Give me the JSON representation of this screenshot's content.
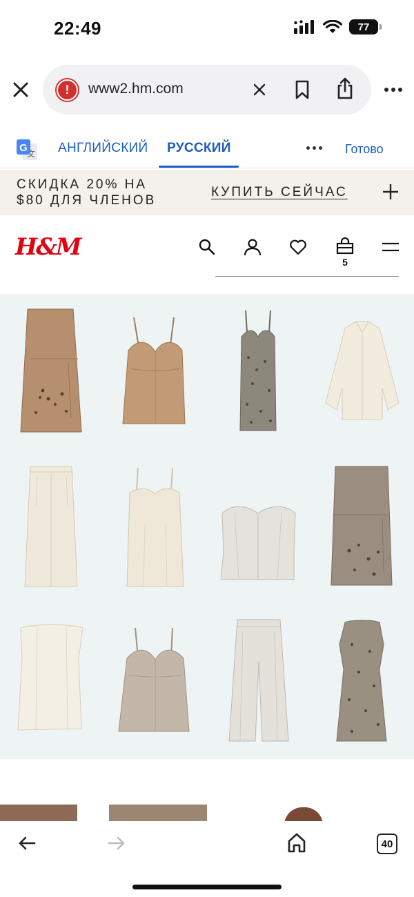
{
  "status": {
    "time": "22:49",
    "battery": "77"
  },
  "browser": {
    "url": "www2.hm.com",
    "tab_count": "40"
  },
  "translate": {
    "lang_source": "АНГЛИЙСКИЙ",
    "lang_target": "РУССКИЙ",
    "done": "Готово"
  },
  "promo": {
    "text_line1": "СКИДКА 20% НА",
    "text_line2": "$80 ДЛЯ ЧЛЕНОВ",
    "link": "КУПИТЬ СЕЙЧАС"
  },
  "header": {
    "logo": "H&M",
    "cart_count": "5"
  },
  "products": [
    {
      "name": "skirt-embellished",
      "color": "#b58f6e"
    },
    {
      "name": "camisole-top",
      "color": "#c29a75"
    },
    {
      "name": "slip-dress-embellished",
      "color": "#8c887c"
    },
    {
      "name": "shirt",
      "color": "#f2ecdf"
    },
    {
      "name": "wide-trousers",
      "color": "#efe9dc"
    },
    {
      "name": "slip-dress",
      "color": "#efe8d8"
    },
    {
      "name": "bustier-top",
      "color": "#e4e2dc"
    },
    {
      "name": "skirt-embellished-2",
      "color": "#9a8e80"
    },
    {
      "name": "bandeau-dress",
      "color": "#f3efe4"
    },
    {
      "name": "camisole-top-2",
      "color": "#c2b7a8"
    },
    {
      "name": "tailored-trousers",
      "color": "#e3e1da"
    },
    {
      "name": "sleeveless-dress-embellished",
      "color": "#999082"
    }
  ]
}
